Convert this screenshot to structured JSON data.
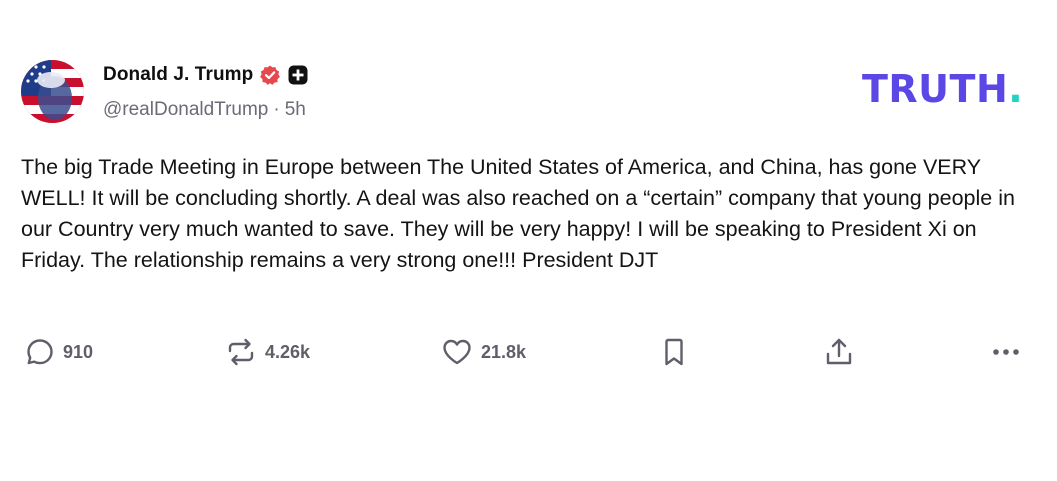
{
  "post": {
    "author": {
      "display_name": "Donald J. Trump",
      "handle": "@realDonaldTrump",
      "separator": "·",
      "time_ago": "5h"
    },
    "brand": {
      "logo_text": "TRUTH",
      "logo_dot": ".",
      "logo_color": "#5b47e6",
      "dot_color": "#1fd4c3"
    },
    "body": "The big Trade Meeting in Europe between The United States of America, and China,  has gone VERY WELL! It will be concluding shortly. A deal was also reached on a “certain” company that young people in our Country very much wanted to save. They will be very happy! I will be speaking to President Xi on Friday. The relationship remains a very strong one!!! President DJT",
    "actions": {
      "replies": {
        "icon": "reply-icon",
        "count": "910"
      },
      "retruths": {
        "icon": "retruth-icon",
        "count": "4.26k"
      },
      "likes": {
        "icon": "heart-icon",
        "count": "21.8k"
      },
      "bookmark": {
        "icon": "bookmark-icon"
      },
      "share": {
        "icon": "share-icon"
      },
      "more": {
        "icon": "more-icon"
      }
    },
    "verified_badge_color": "#e5484d",
    "icon_color": "#5f5f6a"
  }
}
